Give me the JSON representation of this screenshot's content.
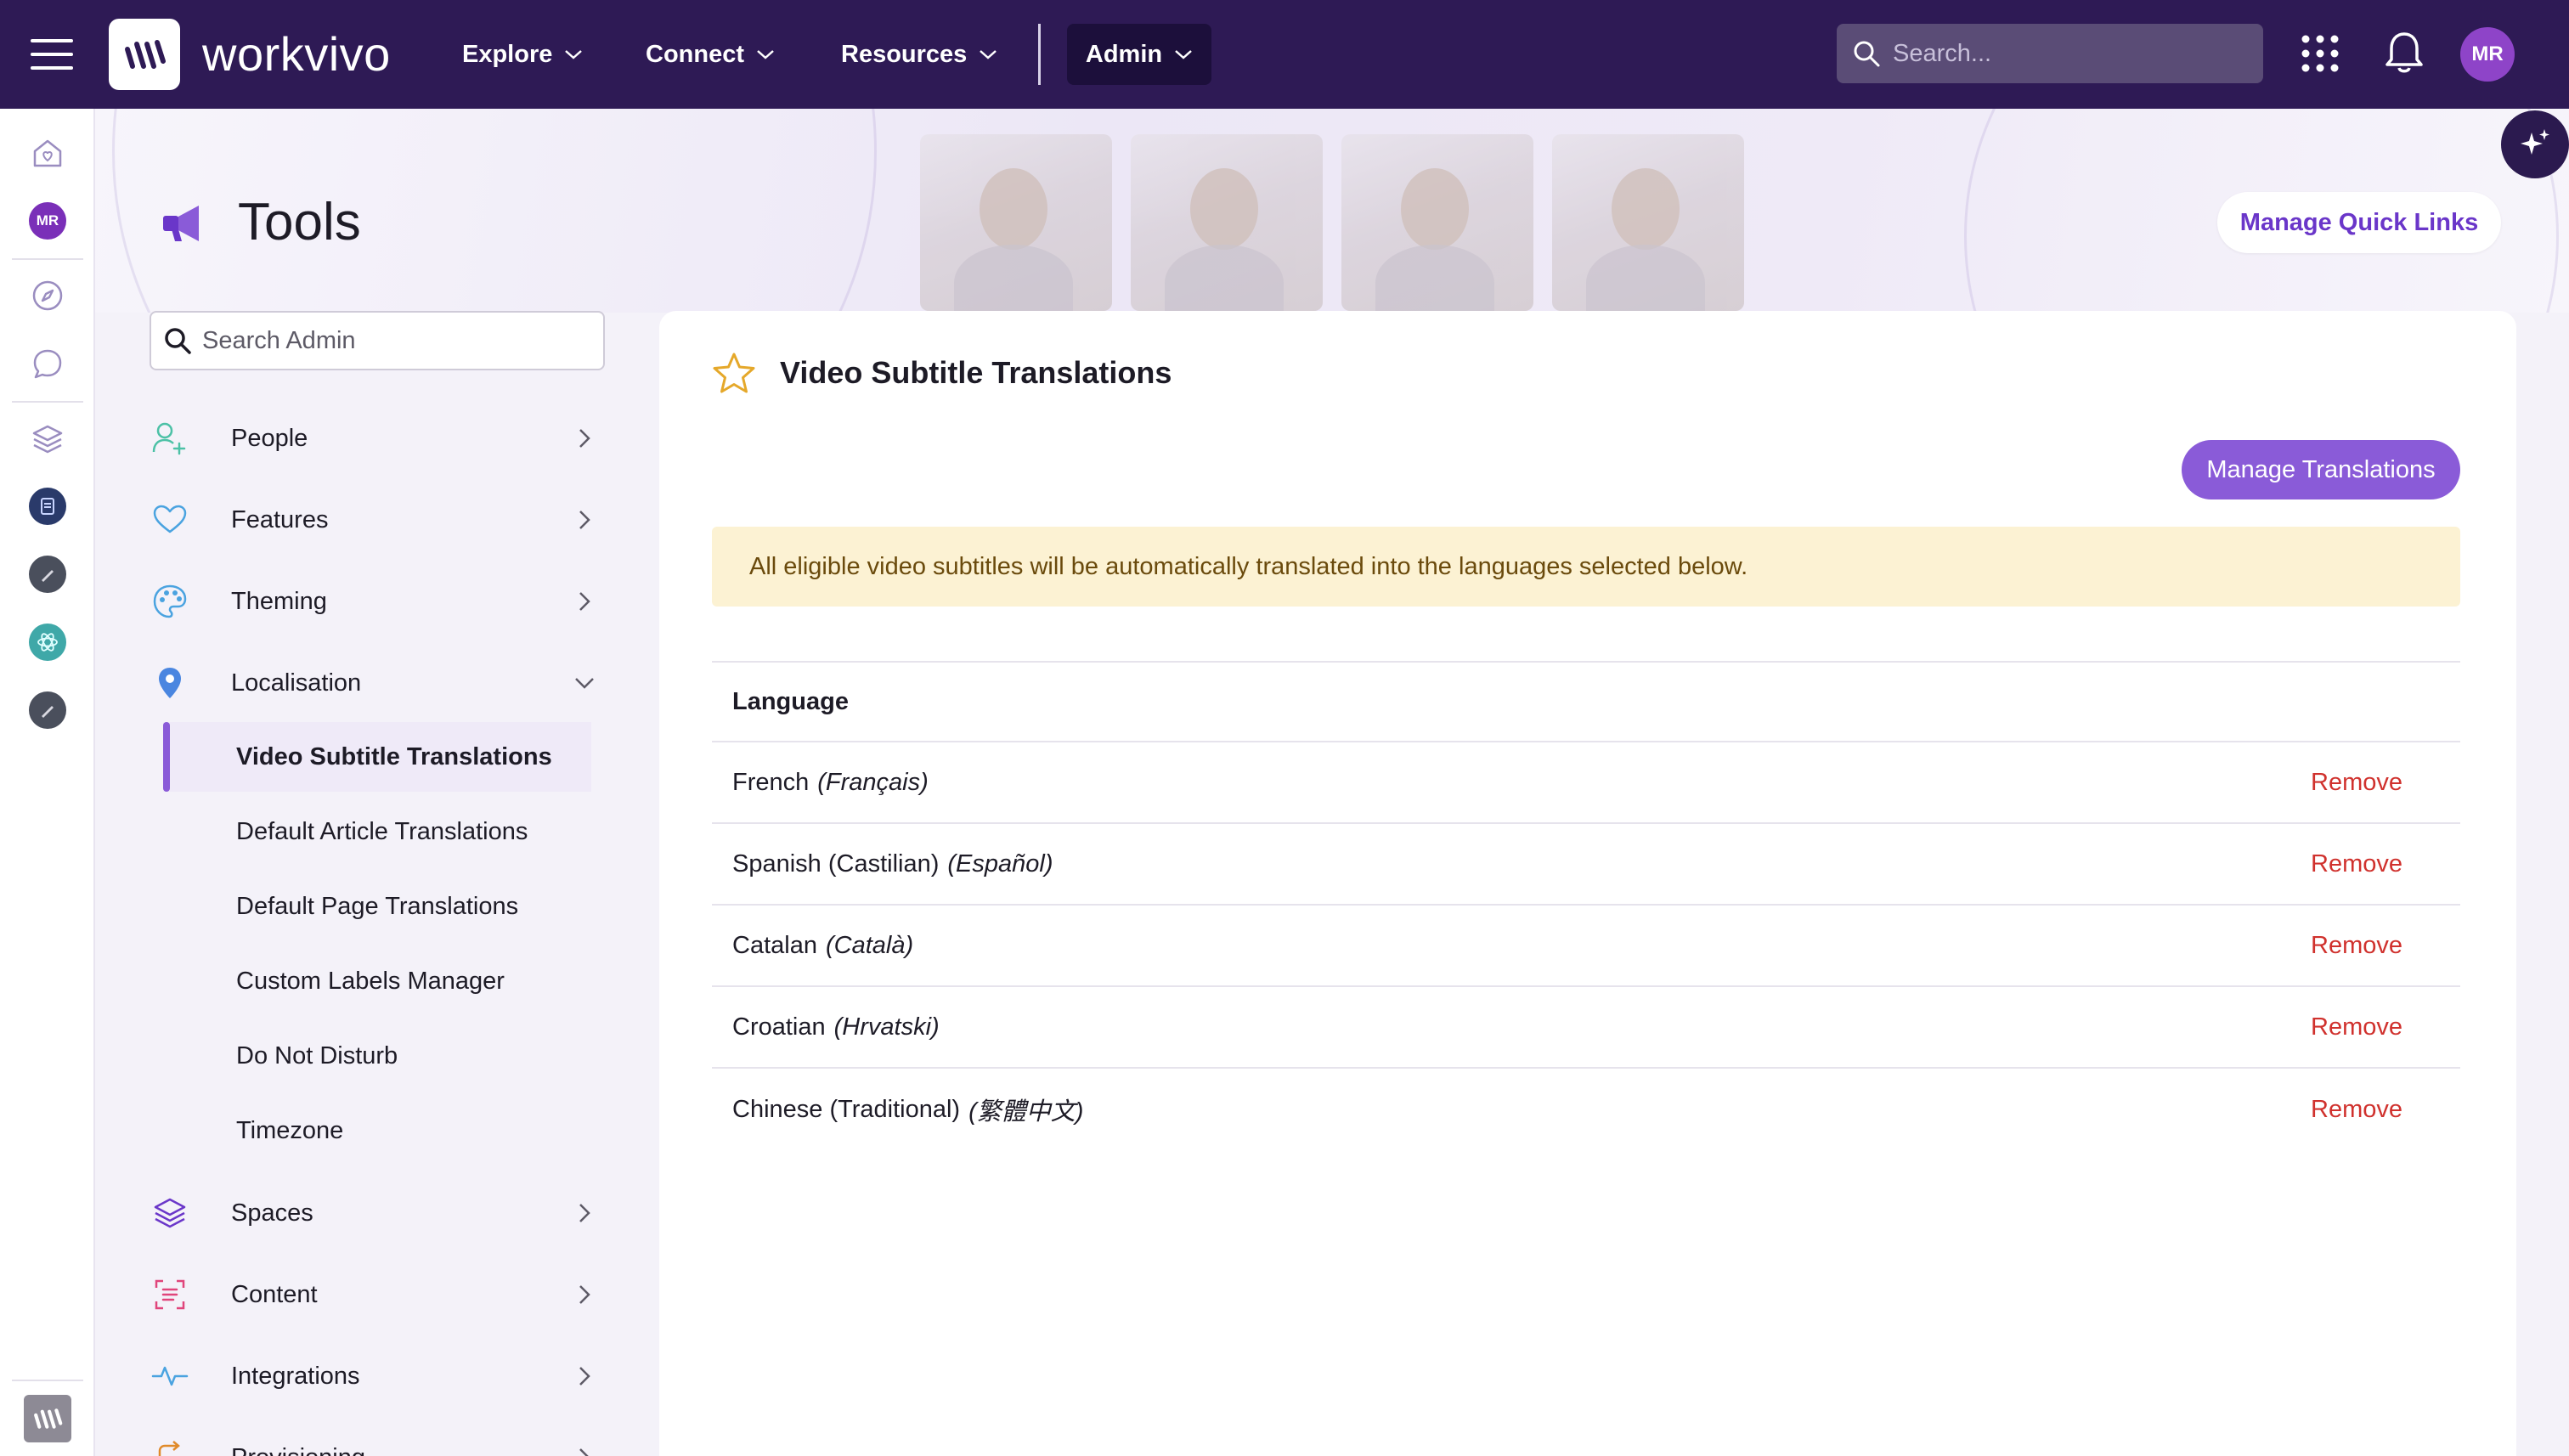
{
  "header": {
    "logo_text": "workvivo",
    "nav": [
      {
        "label": "Explore"
      },
      {
        "label": "Connect"
      },
      {
        "label": "Resources"
      }
    ],
    "admin_label": "Admin",
    "search_placeholder": "Search...",
    "avatar_initials": "MR"
  },
  "rail": {
    "avatar_initials": "MR"
  },
  "page": {
    "title": "Tools",
    "quick_links_label": "Manage Quick Links"
  },
  "admin_sidebar": {
    "search_placeholder": "Search Admin",
    "items": [
      {
        "label": "People"
      },
      {
        "label": "Features"
      },
      {
        "label": "Theming"
      },
      {
        "label": "Localisation"
      },
      {
        "label": "Spaces"
      },
      {
        "label": "Content"
      },
      {
        "label": "Integrations"
      },
      {
        "label": "Provisioning"
      }
    ],
    "localisation_sub": [
      {
        "label": "Video Subtitle Translations",
        "active": true
      },
      {
        "label": "Default Article Translations"
      },
      {
        "label": "Default Page Translations"
      },
      {
        "label": "Custom Labels Manager"
      },
      {
        "label": "Do Not Disturb"
      },
      {
        "label": "Timezone"
      }
    ]
  },
  "main": {
    "title": "Video Subtitle Translations",
    "manage_button": "Manage Translations",
    "notice": "All eligible video subtitles will be automatically translated into the languages selected below.",
    "table": {
      "header": "Language",
      "remove_label": "Remove",
      "rows": [
        {
          "name": "French",
          "native": "(Français)"
        },
        {
          "name": "Spanish (Castilian)",
          "native": "(Español)"
        },
        {
          "name": "Catalan",
          "native": "(Català)"
        },
        {
          "name": "Croatian",
          "native": "(Hrvatski)"
        },
        {
          "name": "Chinese (Traditional)",
          "native": "(繁體中文)"
        }
      ]
    }
  },
  "colors": {
    "topbar": "#2e1a55",
    "accent": "#8a5bd8",
    "remove": "#d0312d",
    "notice_bg": "#fcf2d3"
  }
}
